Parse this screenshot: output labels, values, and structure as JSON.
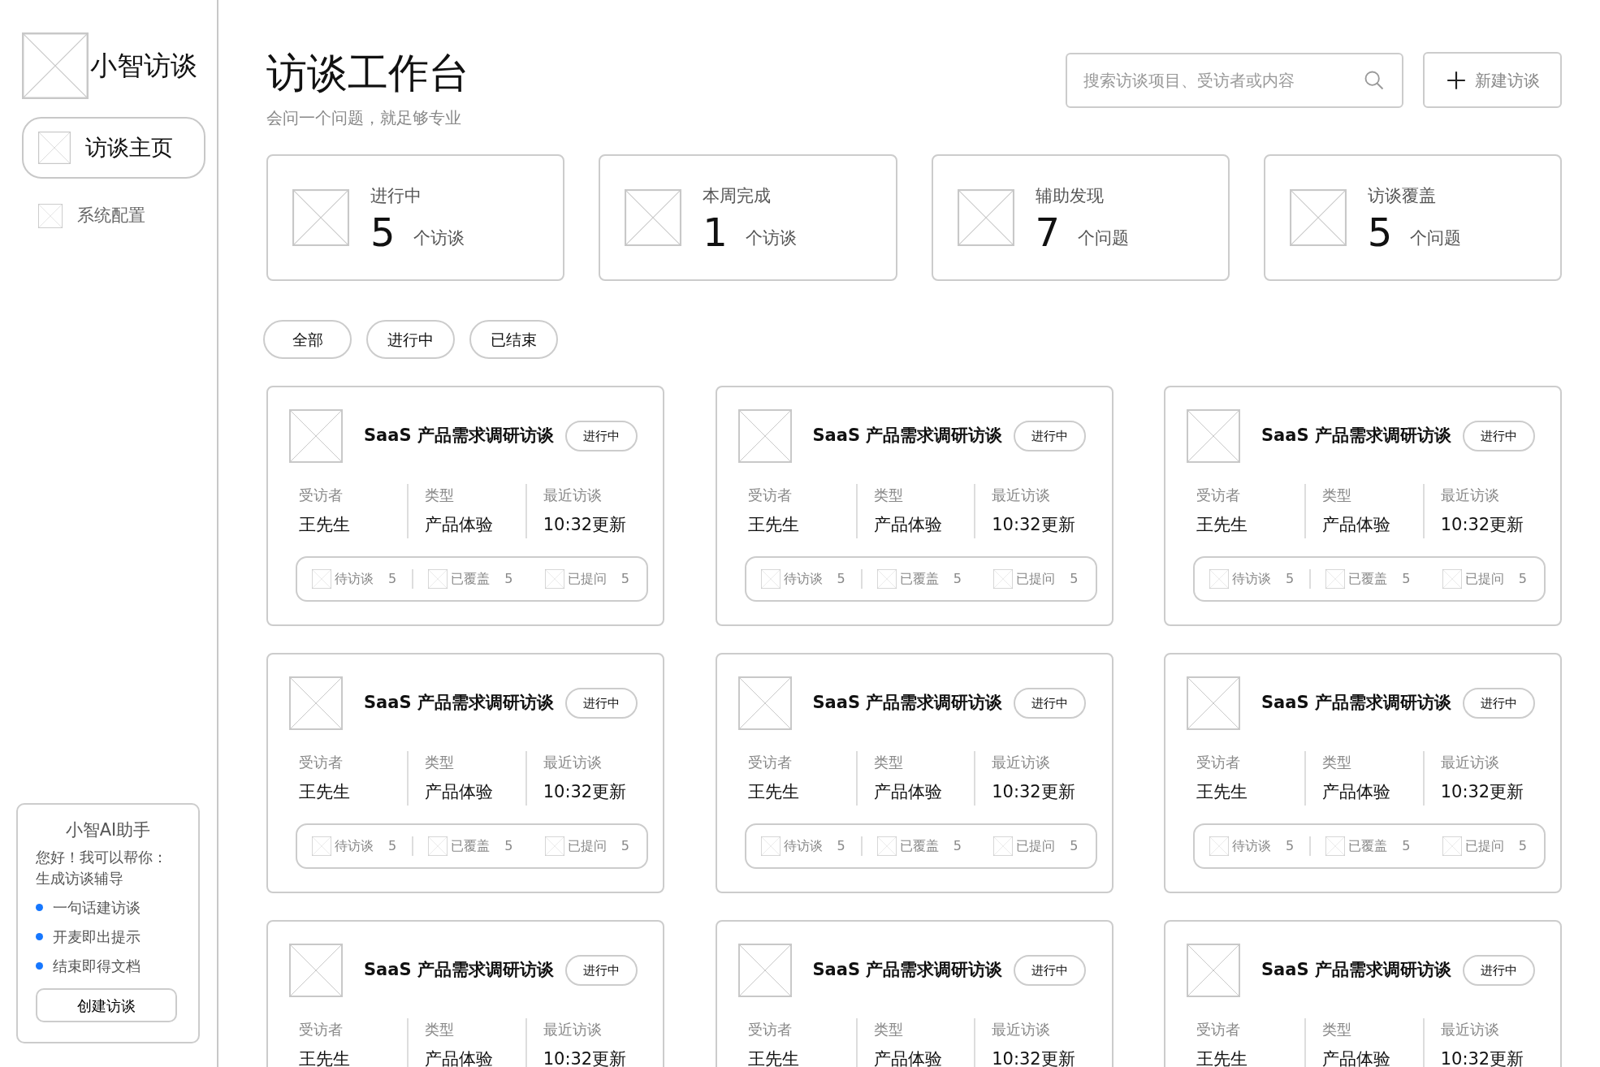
{
  "sidebar": {
    "logo_text": "小智访谈",
    "nav": [
      {
        "label": "访谈主页",
        "selected": true
      },
      {
        "label": "系统配置",
        "selected": false
      }
    ],
    "assistant": {
      "title": "小智AI助手",
      "intro": [
        "您好！我可以帮你：",
        "生成访谈辅导"
      ],
      "features": [
        "一句话建访谈",
        "开麦即出提示",
        "结束即得文档"
      ],
      "button": "创建访谈"
    }
  },
  "header": {
    "title": "访谈工作台",
    "subtitle": "会问一个问题，就足够专业",
    "search": {
      "placeholder": "搜索访谈项目、受访者或内容"
    },
    "new_button": "新建访谈"
  },
  "stats": [
    {
      "label": "进行中",
      "value": "5",
      "unit": "个访谈"
    },
    {
      "label": "本周完成",
      "value": "1",
      "unit": "个访谈"
    },
    {
      "label": "辅助发现",
      "value": "7",
      "unit": "个问题"
    },
    {
      "label": "访谈覆盖",
      "value": "5",
      "unit": "个问题"
    }
  ],
  "filters": [
    {
      "label": "全部",
      "selected": false
    },
    {
      "label": "进行中",
      "selected": false
    },
    {
      "label": "已结束",
      "selected": false
    }
  ],
  "projects": [
    {
      "title": "SaaS 产品需求调研访谈",
      "status": "进行中",
      "fields": [
        {
          "label": "受访者",
          "value": "王先生"
        },
        {
          "label": "类型",
          "value": "产品体验"
        },
        {
          "label": "最近访谈",
          "value": "10:32更新"
        }
      ],
      "counts": [
        {
          "label": "待访谈",
          "value": "5"
        },
        {
          "label": "已覆盖",
          "value": "5"
        },
        {
          "label": "已提问",
          "value": "5"
        }
      ]
    },
    {
      "title": "SaaS 产品需求调研访谈",
      "status": "进行中",
      "fields": [
        {
          "label": "受访者",
          "value": "王先生"
        },
        {
          "label": "类型",
          "value": "产品体验"
        },
        {
          "label": "最近访谈",
          "value": "10:32更新"
        }
      ],
      "counts": [
        {
          "label": "待访谈",
          "value": "5"
        },
        {
          "label": "已覆盖",
          "value": "5"
        },
        {
          "label": "已提问",
          "value": "5"
        }
      ]
    },
    {
      "title": "SaaS 产品需求调研访谈",
      "status": "进行中",
      "fields": [
        {
          "label": "受访者",
          "value": "王先生"
        },
        {
          "label": "类型",
          "value": "产品体验"
        },
        {
          "label": "最近访谈",
          "value": "10:32更新"
        }
      ],
      "counts": [
        {
          "label": "待访谈",
          "value": "5"
        },
        {
          "label": "已覆盖",
          "value": "5"
        },
        {
          "label": "已提问",
          "value": "5"
        }
      ]
    },
    {
      "title": "SaaS 产品需求调研访谈",
      "status": "进行中",
      "fields": [
        {
          "label": "受访者",
          "value": "王先生"
        },
        {
          "label": "类型",
          "value": "产品体验"
        },
        {
          "label": "最近访谈",
          "value": "10:32更新"
        }
      ],
      "counts": [
        {
          "label": "待访谈",
          "value": "5"
        },
        {
          "label": "已覆盖",
          "value": "5"
        },
        {
          "label": "已提问",
          "value": "5"
        }
      ]
    },
    {
      "title": "SaaS 产品需求调研访谈",
      "status": "进行中",
      "fields": [
        {
          "label": "受访者",
          "value": "王先生"
        },
        {
          "label": "类型",
          "value": "产品体验"
        },
        {
          "label": "最近访谈",
          "value": "10:32更新"
        }
      ],
      "counts": [
        {
          "label": "待访谈",
          "value": "5"
        },
        {
          "label": "已覆盖",
          "value": "5"
        },
        {
          "label": "已提问",
          "value": "5"
        }
      ]
    },
    {
      "title": "SaaS 产品需求调研访谈",
      "status": "进行中",
      "fields": [
        {
          "label": "受访者",
          "value": "王先生"
        },
        {
          "label": "类型",
          "value": "产品体验"
        },
        {
          "label": "最近访谈",
          "value": "10:32更新"
        }
      ],
      "counts": [
        {
          "label": "待访谈",
          "value": "5"
        },
        {
          "label": "已覆盖",
          "value": "5"
        },
        {
          "label": "已提问",
          "value": "5"
        }
      ]
    },
    {
      "title": "SaaS 产品需求调研访谈",
      "status": "进行中",
      "fields": [
        {
          "label": "受访者",
          "value": "王先生"
        },
        {
          "label": "类型",
          "value": "产品体验"
        },
        {
          "label": "最近访谈",
          "value": "10:32更新"
        }
      ]
    },
    {
      "title": "SaaS 产品需求调研访谈",
      "status": "进行中",
      "fields": [
        {
          "label": "受访者",
          "value": "王先生"
        },
        {
          "label": "类型",
          "value": "产品体验"
        },
        {
          "label": "最近访谈",
          "value": "10:32更新"
        }
      ]
    },
    {
      "title": "SaaS 产品需求调研访谈",
      "status": "进行中",
      "fields": [
        {
          "label": "受访者",
          "value": "王先生"
        },
        {
          "label": "类型",
          "value": "产品体验"
        },
        {
          "label": "最近访谈",
          "value": "10:32更新"
        }
      ]
    }
  ]
}
